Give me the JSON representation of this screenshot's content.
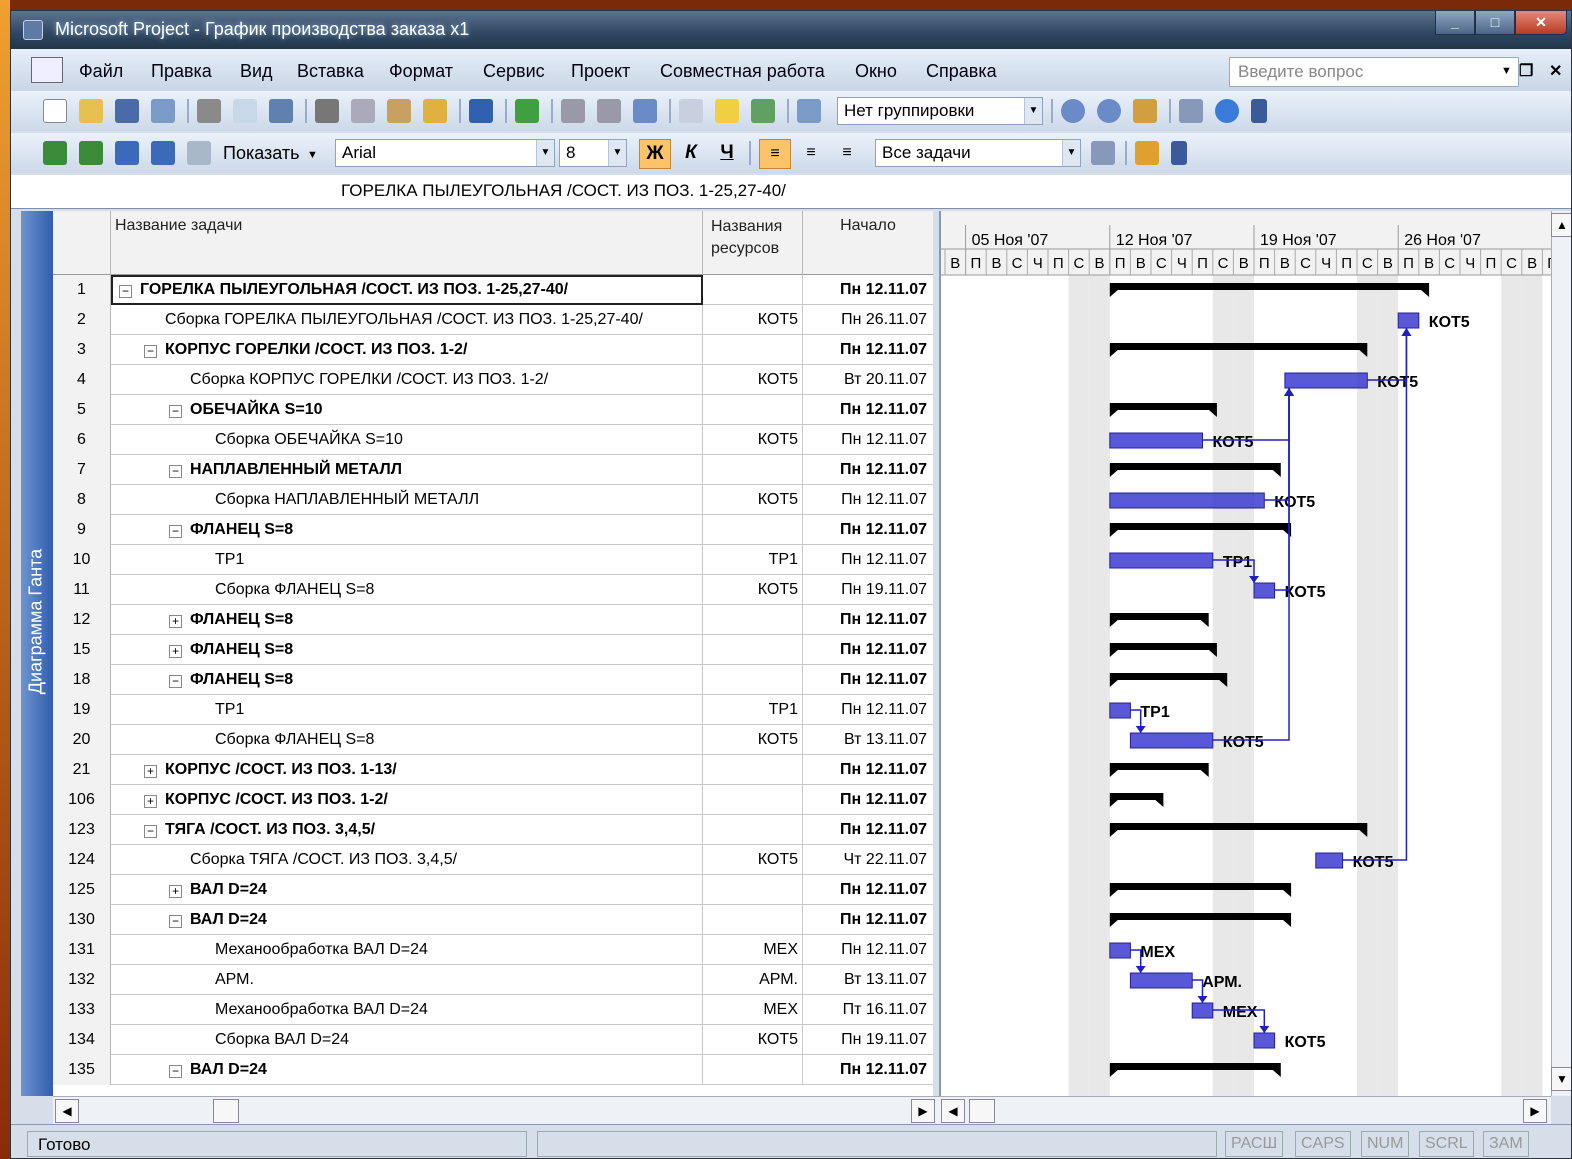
{
  "window": {
    "title": "Microsoft Project - График производства заказа х1"
  },
  "menu": {
    "items": [
      "Файл",
      "Правка",
      "Вид",
      "Вставка",
      "Формат",
      "Сервис",
      "Проект",
      "Совместная работа",
      "Окно",
      "Справка"
    ],
    "help_placeholder": "Введите вопрос"
  },
  "toolbar1": {
    "grouping": "Нет группировки"
  },
  "toolbar2": {
    "show_label": "Показать",
    "font": "Arial",
    "size": "8",
    "bold": "Ж",
    "italic": "К",
    "underline": "Ч",
    "filter": "Все задачи"
  },
  "entry_bar": {
    "value": "ГОРЕЛКА ПЫЛЕУГОЛЬНАЯ /СОСТ. ИЗ ПОЗ. 1-25,27-40/"
  },
  "view_bar": {
    "label": "Диаграмма Ганта"
  },
  "columns": {
    "name": "Название задачи",
    "resources_1": "Названия",
    "resources_2": "ресурсов",
    "start": "Начало"
  },
  "weeks": [
    "05 Ноя '07",
    "12 Ноя '07",
    "19 Ноя '07",
    "26 Ноя '07"
  ],
  "day_letters": [
    "В",
    "П",
    "В",
    "С",
    "Ч",
    "П",
    "С",
    "В",
    "П",
    "В",
    "С",
    "Ч",
    "П",
    "С",
    "В",
    "П",
    "В",
    "С",
    "Ч",
    "П",
    "С",
    "В",
    "П",
    "В",
    "С",
    "Ч",
    "П",
    "С",
    "В",
    "П"
  ],
  "tasks": [
    {
      "id": "1",
      "name": "ГОРЕЛКА ПЫЛЕУГОЛЬНАЯ /СОСТ. ИЗ ПОЗ. 1-25,27-40/",
      "res": "",
      "start": "Пн 12.11.07",
      "level": 0,
      "summary": true,
      "toggle": "−"
    },
    {
      "id": "2",
      "name": "Сборка ГОРЕЛКА ПЫЛЕУГОЛЬНАЯ /СОСТ. ИЗ ПОЗ. 1-25,27-40/",
      "res": "КОТ5",
      "start": "Пн 26.11.07",
      "level": 1,
      "summary": false,
      "toggle": ""
    },
    {
      "id": "3",
      "name": "КОРПУС ГОРЕЛКИ /СОСТ. ИЗ ПОЗ. 1-2/",
      "res": "",
      "start": "Пн 12.11.07",
      "level": 1,
      "summary": true,
      "toggle": "−"
    },
    {
      "id": "4",
      "name": "Сборка КОРПУС ГОРЕЛКИ /СОСТ. ИЗ ПОЗ. 1-2/",
      "res": "КОТ5",
      "start": "Вт 20.11.07",
      "level": 2,
      "summary": false,
      "toggle": ""
    },
    {
      "id": "5",
      "name": "ОБЕЧАЙКА S=10",
      "res": "",
      "start": "Пн 12.11.07",
      "level": 2,
      "summary": true,
      "toggle": "−"
    },
    {
      "id": "6",
      "name": "Сборка ОБЕЧАЙКА S=10",
      "res": "КОТ5",
      "start": "Пн 12.11.07",
      "level": 3,
      "summary": false,
      "toggle": ""
    },
    {
      "id": "7",
      "name": "НАПЛАВЛЕННЫЙ МЕТАЛЛ",
      "res": "",
      "start": "Пн 12.11.07",
      "level": 2,
      "summary": true,
      "toggle": "−"
    },
    {
      "id": "8",
      "name": "Сборка НАПЛАВЛЕННЫЙ МЕТАЛЛ",
      "res": "КОТ5",
      "start": "Пн 12.11.07",
      "level": 3,
      "summary": false,
      "toggle": ""
    },
    {
      "id": "9",
      "name": "ФЛАНЕЦ S=8",
      "res": "",
      "start": "Пн 12.11.07",
      "level": 2,
      "summary": true,
      "toggle": "−"
    },
    {
      "id": "10",
      "name": "ТР1",
      "res": "ТР1",
      "start": "Пн 12.11.07",
      "level": 3,
      "summary": false,
      "toggle": ""
    },
    {
      "id": "11",
      "name": "Сборка ФЛАНЕЦ S=8",
      "res": "КОТ5",
      "start": "Пн 19.11.07",
      "level": 3,
      "summary": false,
      "toggle": ""
    },
    {
      "id": "12",
      "name": "ФЛАНЕЦ S=8",
      "res": "",
      "start": "Пн 12.11.07",
      "level": 2,
      "summary": true,
      "toggle": "+"
    },
    {
      "id": "15",
      "name": "ФЛАНЕЦ S=8",
      "res": "",
      "start": "Пн 12.11.07",
      "level": 2,
      "summary": true,
      "toggle": "+"
    },
    {
      "id": "18",
      "name": "ФЛАНЕЦ S=8",
      "res": "",
      "start": "Пн 12.11.07",
      "level": 2,
      "summary": true,
      "toggle": "−"
    },
    {
      "id": "19",
      "name": "ТР1",
      "res": "ТР1",
      "start": "Пн 12.11.07",
      "level": 3,
      "summary": false,
      "toggle": ""
    },
    {
      "id": "20",
      "name": "Сборка ФЛАНЕЦ S=8",
      "res": "КОТ5",
      "start": "Вт 13.11.07",
      "level": 3,
      "summary": false,
      "toggle": ""
    },
    {
      "id": "21",
      "name": "КОРПУС /СОСТ. ИЗ ПОЗ. 1-13/",
      "res": "",
      "start": "Пн 12.11.07",
      "level": 1,
      "summary": true,
      "toggle": "+"
    },
    {
      "id": "106",
      "name": "КОРПУС /СОСТ. ИЗ ПОЗ. 1-2/",
      "res": "",
      "start": "Пн 12.11.07",
      "level": 1,
      "summary": true,
      "toggle": "+"
    },
    {
      "id": "123",
      "name": "ТЯГА /СОСТ. ИЗ ПОЗ. 3,4,5/",
      "res": "",
      "start": "Пн 12.11.07",
      "level": 1,
      "summary": true,
      "toggle": "−"
    },
    {
      "id": "124",
      "name": "Сборка ТЯГА /СОСТ. ИЗ ПОЗ. 3,4,5/",
      "res": "КОТ5",
      "start": "Чт 22.11.07",
      "level": 2,
      "summary": false,
      "toggle": ""
    },
    {
      "id": "125",
      "name": "ВАЛ D=24",
      "res": "",
      "start": "Пн 12.11.07",
      "level": 2,
      "summary": true,
      "toggle": "+"
    },
    {
      "id": "130",
      "name": "ВАЛ D=24",
      "res": "",
      "start": "Пн 12.11.07",
      "level": 2,
      "summary": true,
      "toggle": "−"
    },
    {
      "id": "131",
      "name": "Механообработка ВАЛ D=24",
      "res": "МЕХ",
      "start": "Пн 12.11.07",
      "level": 3,
      "summary": false,
      "toggle": ""
    },
    {
      "id": "132",
      "name": "АРМ.",
      "res": "АРМ.",
      "start": "Вт 13.11.07",
      "level": 3,
      "summary": false,
      "toggle": ""
    },
    {
      "id": "133",
      "name": "Механообработка ВАЛ D=24",
      "res": "МЕХ",
      "start": "Пт 16.11.07",
      "level": 3,
      "summary": false,
      "toggle": ""
    },
    {
      "id": "134",
      "name": "Сборка ВАЛ D=24",
      "res": "КОТ5",
      "start": "Пн 19.11.07",
      "level": 3,
      "summary": false,
      "toggle": ""
    },
    {
      "id": "135",
      "name": "ВАЛ D=24",
      "res": "",
      "start": "Пн 12.11.07",
      "level": 2,
      "summary": true,
      "toggle": "−"
    }
  ],
  "status": {
    "ready": "Готово",
    "indicators": [
      "РАСШ",
      "CAPS",
      "NUM",
      "SCRL",
      "ЗАМ"
    ]
  }
}
